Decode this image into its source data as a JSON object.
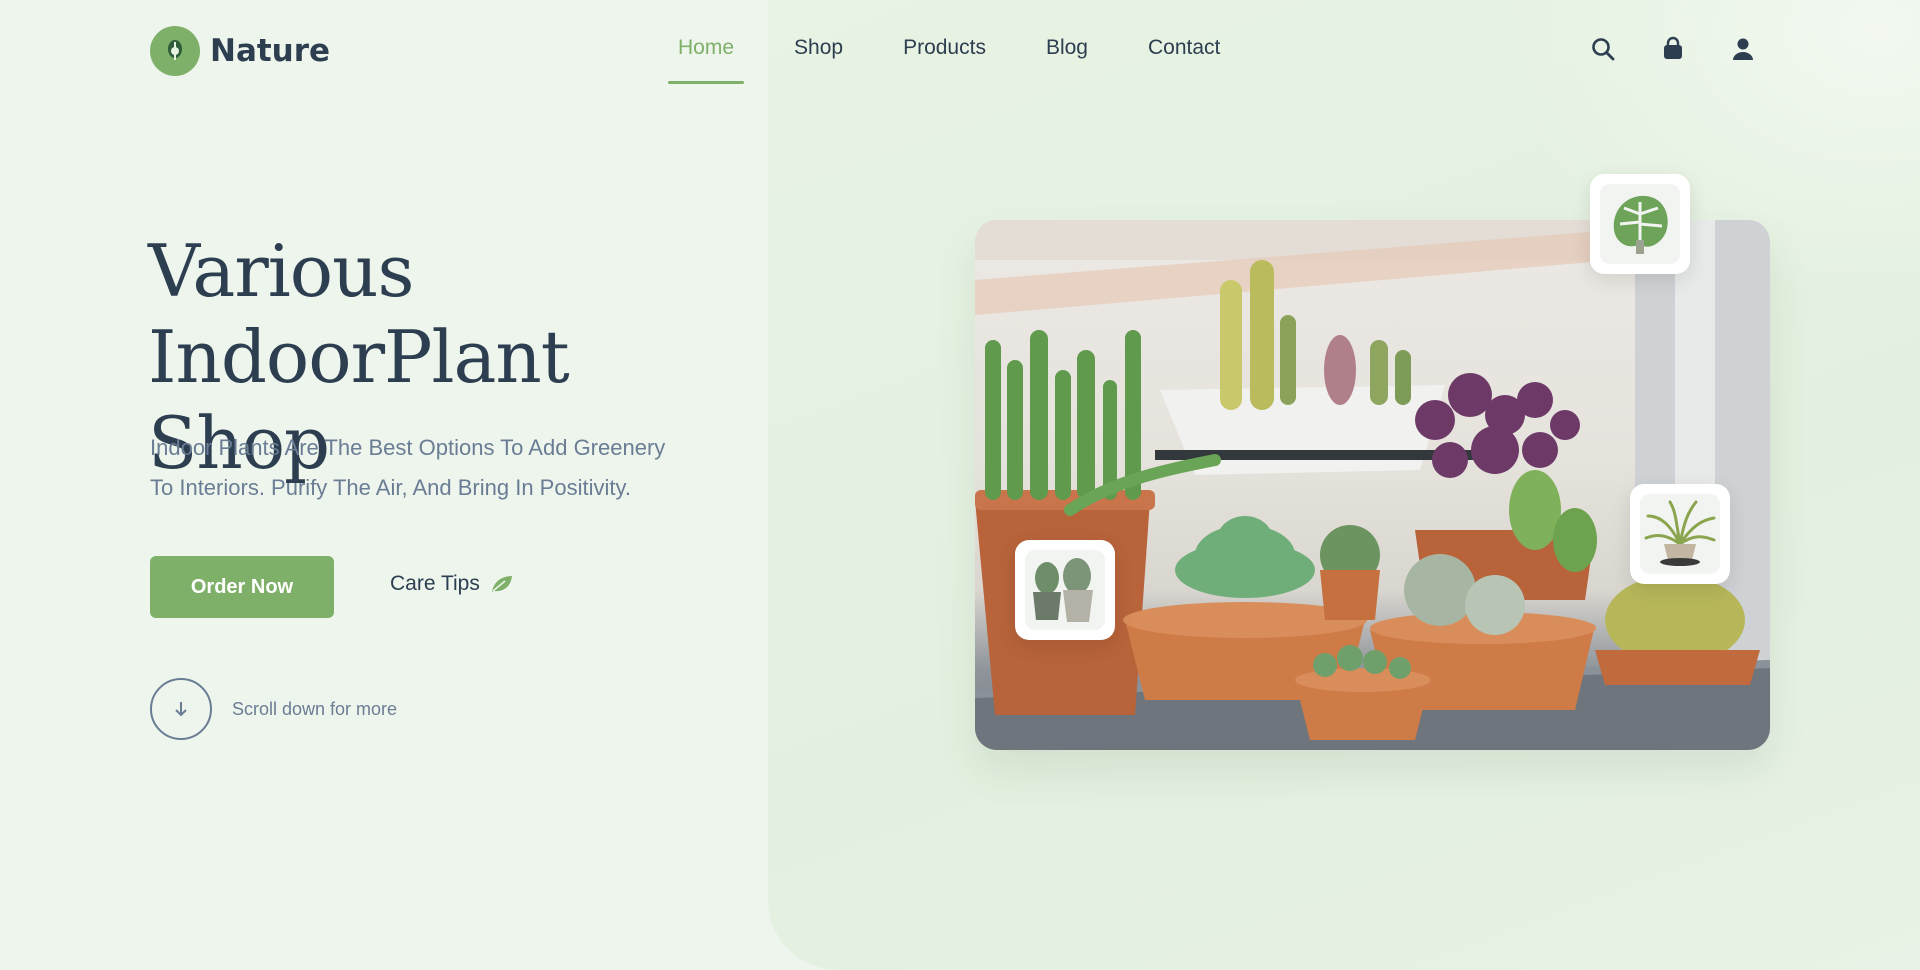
{
  "brand": {
    "name": "Nature",
    "accent": "#7fb069",
    "text": "#2c3e50",
    "muted": "#6b7d95"
  },
  "nav": {
    "items": [
      {
        "label": "Home",
        "active": true
      },
      {
        "label": "Shop",
        "active": false
      },
      {
        "label": "Products",
        "active": false
      },
      {
        "label": "Blog",
        "active": false
      },
      {
        "label": "Contact",
        "active": false
      }
    ]
  },
  "header_icons": [
    "search-icon",
    "shopping-bag-icon",
    "user-icon"
  ],
  "hero": {
    "title_line1": "Various IndoorPlant",
    "title_line2": "Shop",
    "desc_line1": "Indoor Plants Are The Best Options To Add Greenery",
    "desc_line2": "To Interiors. Purify The Air, And Bring In Positivity.",
    "order_label": "Order Now",
    "care_label": "Care Tips",
    "scroll_label": "Scroll down for more"
  },
  "gallery": {
    "thumbnails": [
      "monstera-thumbnail",
      "cactus-pots-thumbnail",
      "spider-plant-thumbnail"
    ]
  }
}
